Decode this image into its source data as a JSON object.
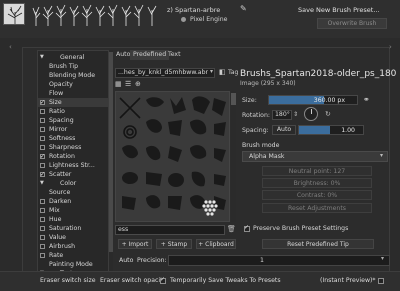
{
  "header": {
    "brush_name": "z) Spartan-arbre",
    "engine_label": "Pixel Engine",
    "save_new_label": "Save New Brush Preset...",
    "overwrite_label": "Overwrite Brush"
  },
  "options": {
    "items": [
      {
        "label": "General",
        "type": "header"
      },
      {
        "label": "Brush Tip",
        "type": "plain"
      },
      {
        "label": "Blending Mode",
        "type": "plain"
      },
      {
        "label": "Opacity",
        "type": "plain"
      },
      {
        "label": "Flow",
        "type": "plain"
      },
      {
        "label": "Size",
        "type": "check",
        "checked": true,
        "selected": true
      },
      {
        "label": "Ratio",
        "type": "check",
        "checked": false
      },
      {
        "label": "Spacing",
        "type": "check",
        "checked": false
      },
      {
        "label": "Mirror",
        "type": "check",
        "checked": false
      },
      {
        "label": "Softness",
        "type": "check",
        "checked": false
      },
      {
        "label": "Sharpness",
        "type": "check",
        "checked": false
      },
      {
        "label": "Rotation",
        "type": "check",
        "checked": true
      },
      {
        "label": "Lightness Str...",
        "type": "check",
        "checked": false
      },
      {
        "label": "Scatter",
        "type": "check",
        "checked": true
      },
      {
        "label": "Color",
        "type": "header"
      },
      {
        "label": "Source",
        "type": "plain"
      },
      {
        "label": "Darken",
        "type": "check",
        "checked": false
      },
      {
        "label": "Mix",
        "type": "check",
        "checked": false
      },
      {
        "label": "Hue",
        "type": "check",
        "checked": false
      },
      {
        "label": "Saturation",
        "type": "check",
        "checked": false
      },
      {
        "label": "Value",
        "type": "check",
        "checked": false
      },
      {
        "label": "Airbrush",
        "type": "check",
        "checked": false
      },
      {
        "label": "Rate",
        "type": "check",
        "checked": false
      },
      {
        "label": "Painting Mode",
        "type": "plain"
      },
      {
        "label": "Texture",
        "type": "header"
      }
    ]
  },
  "tabs": [
    {
      "label": "Auto"
    },
    {
      "label": "Predefined",
      "active": true
    },
    {
      "label": "Text"
    }
  ],
  "predefined": {
    "source": "...hes_by_knkl_d5mhbww.abr",
    "tag_label": "Tag",
    "filter_value": "ess",
    "import_label": "Import",
    "stamp_label": "Stamp",
    "clipboard_label": "Clipboard"
  },
  "tip": {
    "title": "Brushs_Spartan2018-older_ps_180",
    "dims": "Image (295 x 340)",
    "size_label": "Size:",
    "size_value": "360.00 px",
    "size_fill": 0.62,
    "rotation_label": "Rotation:",
    "rotation_value": "180°",
    "spacing_label": "Spacing:",
    "spacing_auto": "Auto",
    "spacing_value": "1.00",
    "spacing_fill": 0.48,
    "brush_mode_label": "Brush mode",
    "brush_mode_value": "Alpha Mask",
    "neutral_point": "Neutral point: 127",
    "brightness": "Brightness: 0%",
    "contrast": "Contrast: 0%",
    "reset_adjust": "Reset Adjustments",
    "preserve_label": "Preserve Brush Preset Settings",
    "reset_tip": "Reset Predefined Tip"
  },
  "precision": {
    "auto_label": "Auto",
    "label": "Precision:",
    "value": "1"
  },
  "bottom": {
    "eraser_size": "Eraser switch size",
    "eraser_opacity": "Eraser switch opacity",
    "temp_save": "Temporarily Save Tweaks To Presets",
    "instant_preview": "(Instant Preview)*"
  }
}
